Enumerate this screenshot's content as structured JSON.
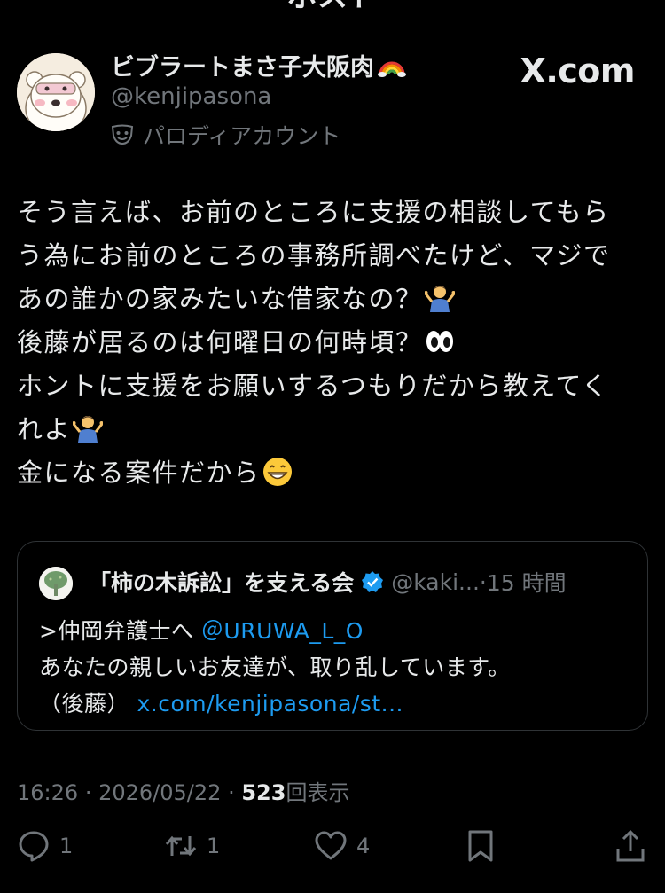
{
  "header": {
    "back_icon": "chevron-left-icon",
    "title": "ポスト"
  },
  "author": {
    "display_name": "ビブラートまさ子大阪肉",
    "handle": "@kenjipasona",
    "label": "パロディアカウント",
    "label_icon": "parody-mask-icon"
  },
  "source": "X.com",
  "post": {
    "lines": [
      "そう言えば、お前のところに支援の相談してもら",
      "う為にお前のところの事務所調べたけど、マジで",
      "あの誰かの家みたいな借家なの？",
      "後藤が居るのは何曜日の何時頃？",
      "ホントに支援をお願いするつもりだから教えてく",
      "れよ",
      "金になる案件だから"
    ]
  },
  "quote": {
    "name": "「柿の木訴訟」を支える会",
    "handle": "@kaki...",
    "dot": "·",
    "time": "15 時間",
    "line1_prefix": ">仲岡弁護士へ ",
    "mention": "＠URUWA_L_O",
    "line2": "あなたの親しいお友達が、取り乱しています。",
    "line3_prefix": "（後藤） ",
    "link": "x.com/kenjipasona/st..."
  },
  "meta": {
    "time": "16:26",
    "date": "2026/05/22",
    "sep": "·",
    "views_count": "523",
    "views_label": "回表示"
  },
  "actions": {
    "reply_count": "1",
    "repost_count": "1",
    "like_count": "4"
  }
}
